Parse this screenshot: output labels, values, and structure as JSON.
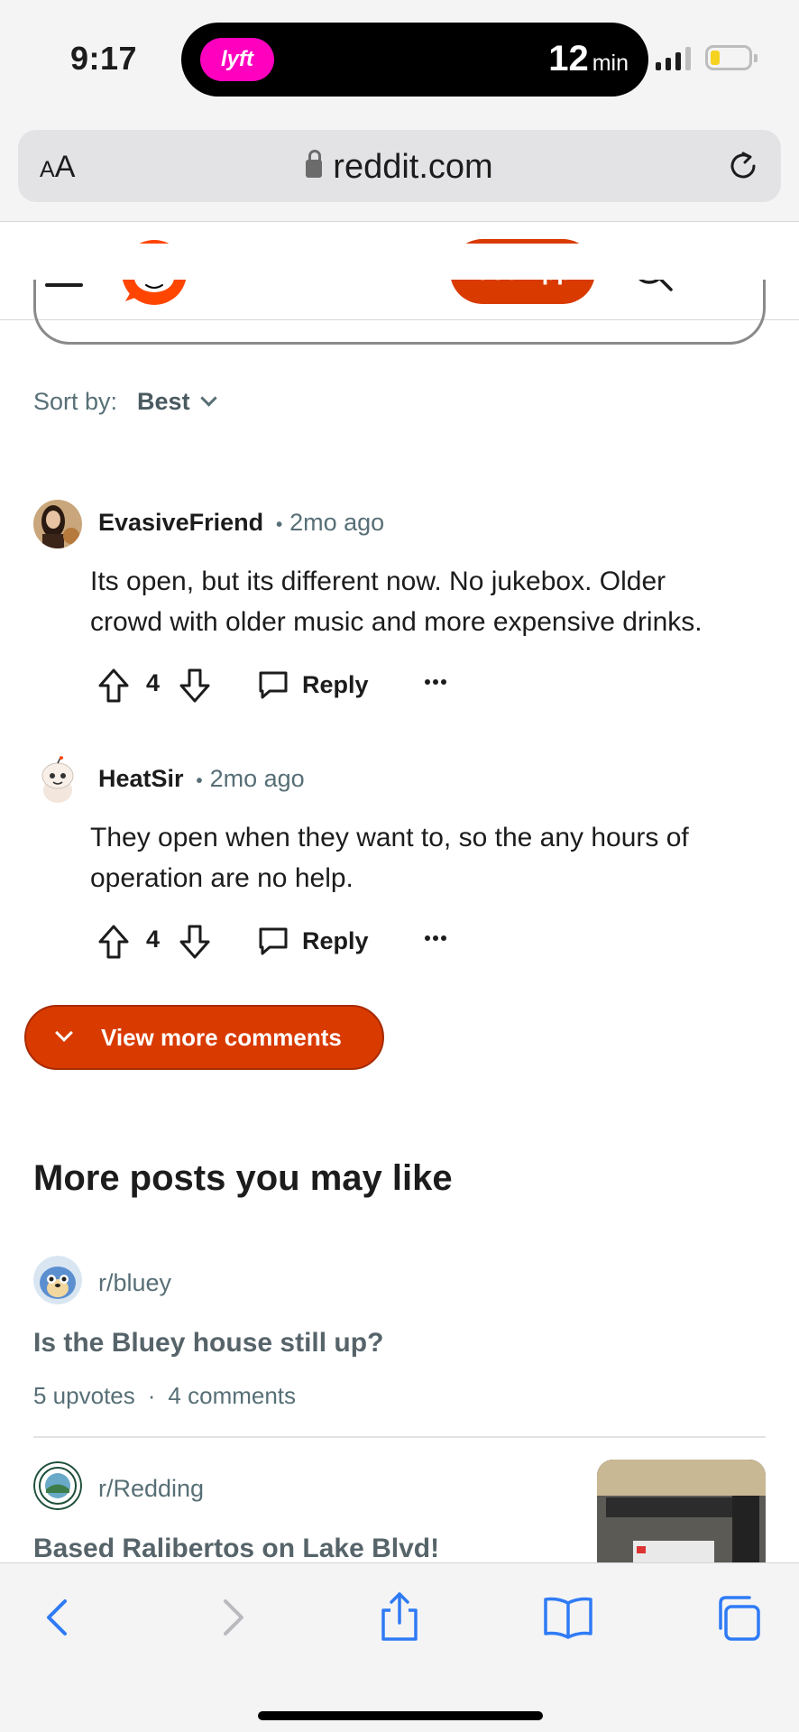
{
  "status_bar": {
    "time": "9:17",
    "live_activity": {
      "app": "lyft",
      "eta_value": "12",
      "eta_unit": "min"
    },
    "signal_bars_active": 3,
    "battery_level": 0.25,
    "battery_color": "#f5d320"
  },
  "browser": {
    "text_size_label": "AA",
    "url": "reddit.com",
    "reload_icon": "reload-icon"
  },
  "reddit_header": {
    "menu_icon": "hamburger-icon",
    "logo": "reddit-snoo-logo",
    "use_app_label": "Use App",
    "search_icon": "search-icon",
    "more_icon": "more-horizontal-icon",
    "brand_color": "#d93a00"
  },
  "sort": {
    "label": "Sort by:",
    "value": "Best"
  },
  "comments": [
    {
      "user": "EvasiveFriend",
      "time": "2mo ago",
      "body_line1": "Its open, but its different now. No jukebox. Older",
      "body_line2": "crowd with older music and more expensive drinks.",
      "votes": "4",
      "reply_label": "Reply"
    },
    {
      "user": "HeatSir",
      "time": "2mo ago",
      "body_line1": "They open when they want to, so the any hours of",
      "body_line2": "operation are no help.",
      "votes": "4",
      "reply_label": "Reply"
    }
  ],
  "view_more_label": "View more comments",
  "more_posts": {
    "title": "More posts you may like",
    "items": [
      {
        "subreddit": "r/bluey",
        "title": "Is the Bluey house still up?",
        "upvotes": "5 upvotes",
        "comments": "4 comments"
      },
      {
        "subreddit": "r/Redding",
        "title": "Based Ralibertos on Lake Blvd!"
      }
    ]
  },
  "safari_toolbar": {
    "icons": [
      "back-icon",
      "forward-icon",
      "share-icon",
      "bookmarks-icon",
      "tabs-icon"
    ],
    "accent_color": "#2f7bf5"
  }
}
